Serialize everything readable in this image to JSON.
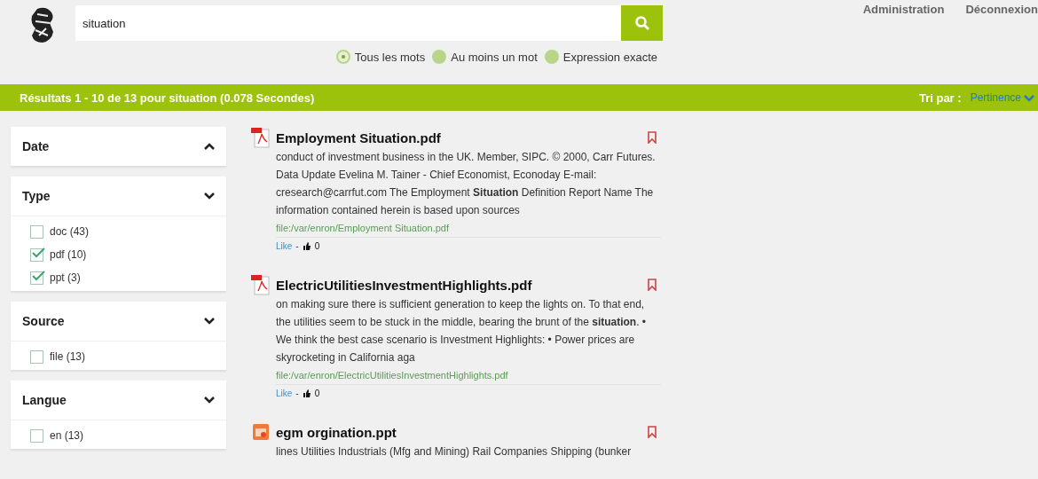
{
  "search": {
    "value": "situation"
  },
  "match_modes": [
    {
      "label": "Tous les mots",
      "selected": true
    },
    {
      "label": "Au moins un mot",
      "selected": false
    },
    {
      "label": "Expression exacte",
      "selected": false
    }
  ],
  "nav": [
    "Administration",
    "Déconnexion"
  ],
  "results_bar": {
    "summary": "Résultats 1 - 10 de 13 pour situation (0.078 Secondes)",
    "sort_label": "Tri par :",
    "sort_value": "Pertinence"
  },
  "facets": [
    {
      "title": "Date",
      "expanded": false
    },
    {
      "title": "Type",
      "expanded": true,
      "items": [
        {
          "label": "doc (43)",
          "checked": false
        },
        {
          "label": "pdf (10)",
          "checked": true
        },
        {
          "label": "ppt (3)",
          "checked": true
        }
      ]
    },
    {
      "title": "Source",
      "expanded": true,
      "items": [
        {
          "label": "file (13)",
          "checked": false
        }
      ]
    },
    {
      "title": "Langue",
      "expanded": true,
      "items": [
        {
          "label": "en (13)",
          "checked": false
        }
      ]
    }
  ],
  "results": [
    {
      "kind": "pdf",
      "title": "Employment Situation.pdf",
      "snippet": "conduct of investment business in the UK. Member, SIPC. © 2000, Carr Futures. Data Update Evelina M. Tainer - Chief Economist, Econoday E-mail: cresearch@carrfut.com The Employment **Situation** Definition Report Name The information contained herein is based upon sources",
      "path": "file:/var/enron/Employment Situation.pdf",
      "like": "Like",
      "separator": "-",
      "likes": "0"
    },
    {
      "kind": "pdf",
      "title": "ElectricUtilitiesInvestmentHighlights.pdf",
      "snippet": "on making sure there is sufficient generation to keep the lights on. To that end, the utilities seem to be stuck in the middle, bearing the brunt of the **situation**. • We think the best case scenario is Investment Highlights: • Power prices are skyrocketing in California aga",
      "path": "file:/var/enron/ElectricUtilitiesInvestmentHighlights.pdf",
      "like": "Like",
      "separator": "-",
      "likes": "0"
    },
    {
      "kind": "ppt",
      "title": "egm orgination.ppt",
      "snippet": "lines Utilities Industrials (Mfg and Mining) Rail Companies Shipping (bunker"
    }
  ]
}
